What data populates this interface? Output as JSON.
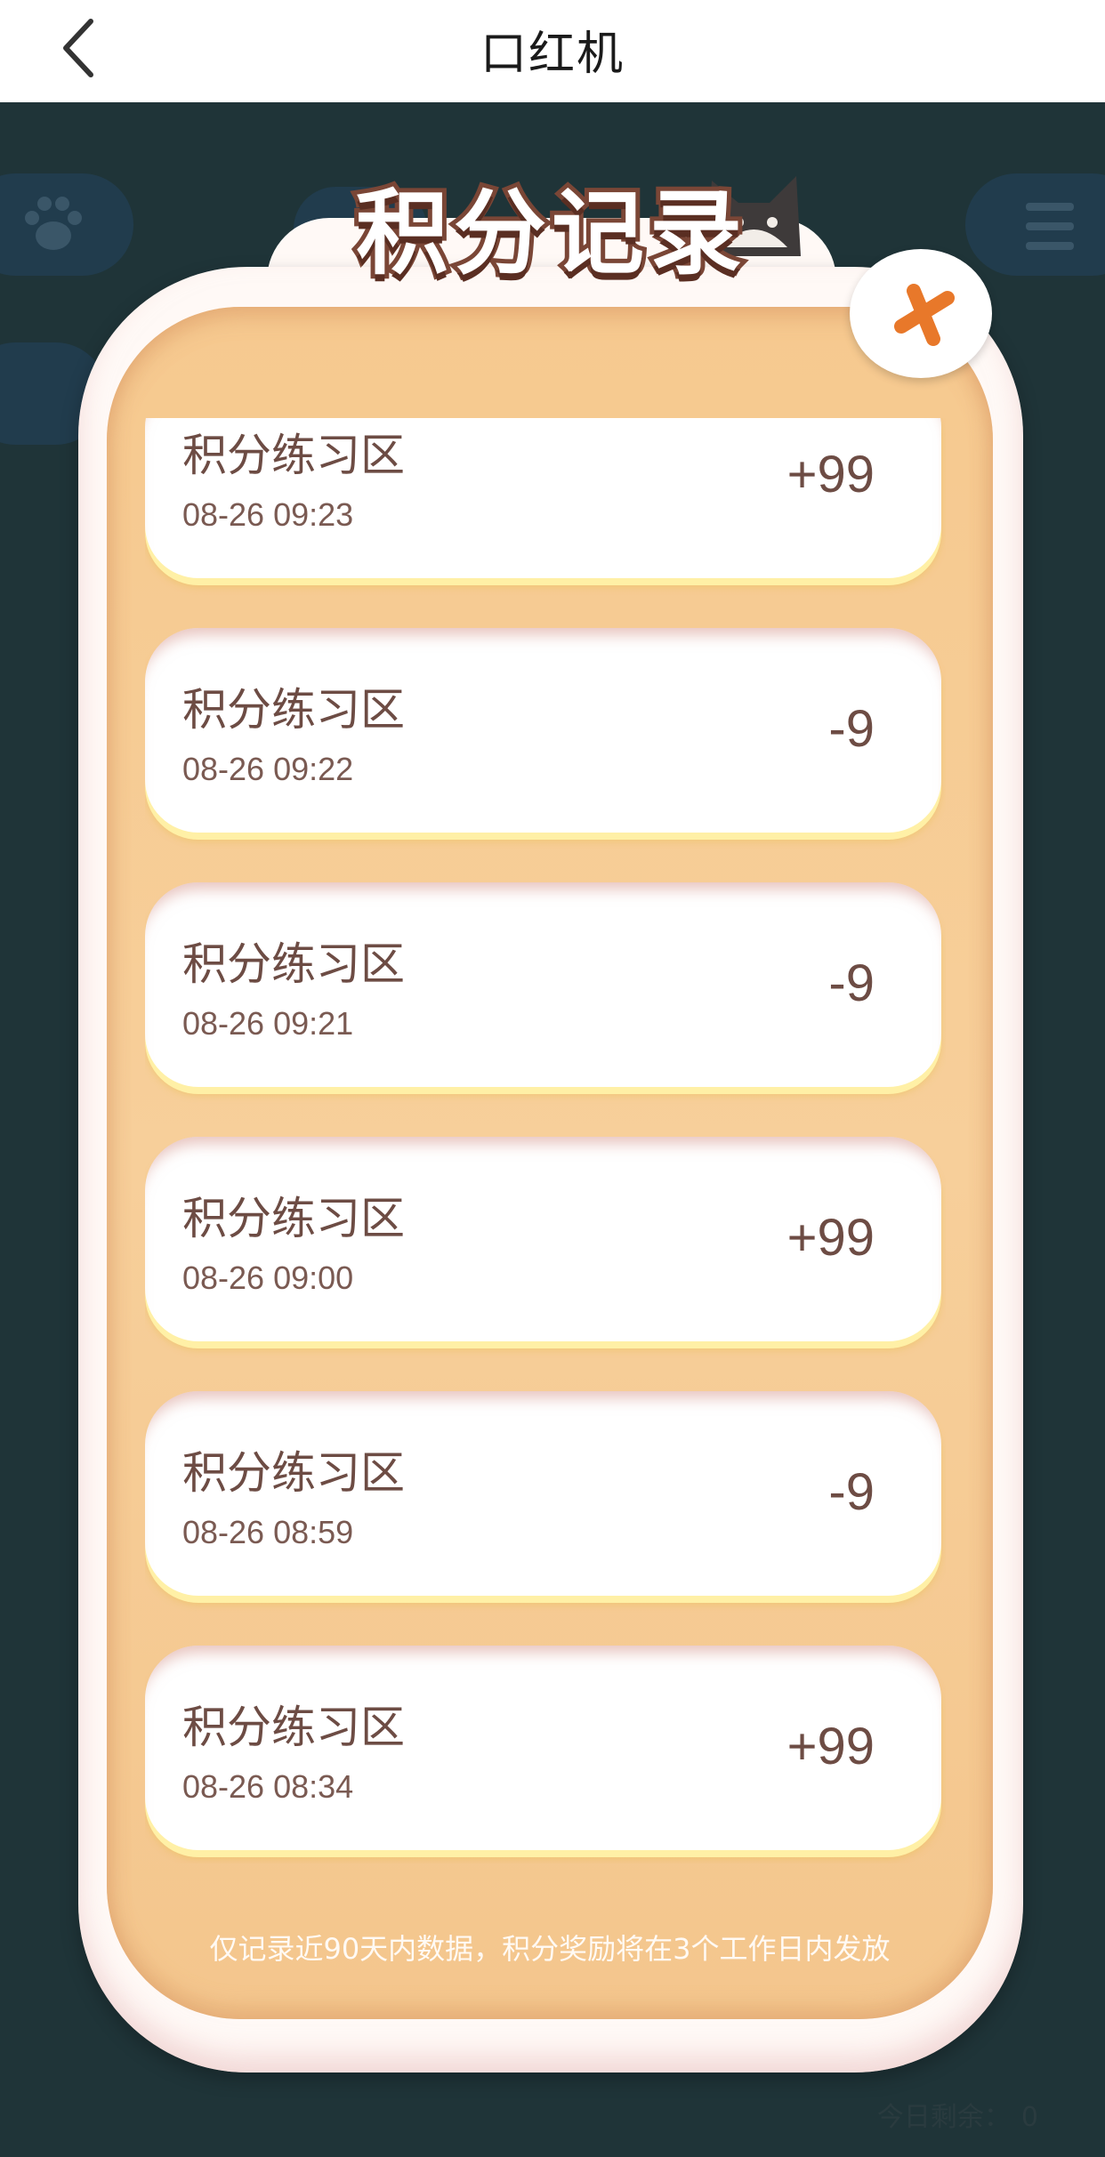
{
  "navbar": {
    "title": "口红机"
  },
  "game_bg": {
    "remaining_label": "今日剩余：",
    "remaining_value": "0"
  },
  "modal": {
    "title": "积分记录",
    "records": [
      {
        "name": "积分练习区",
        "time": "08-26 09:23",
        "points": "+99"
      },
      {
        "name": "积分练习区",
        "time": "08-26 09:22",
        "points": "-9"
      },
      {
        "name": "积分练习区",
        "time": "08-26 09:21",
        "points": "-9"
      },
      {
        "name": "积分练习区",
        "time": "08-26 09:00",
        "points": "+99"
      },
      {
        "name": "积分练习区",
        "time": "08-26 08:59",
        "points": "-9"
      },
      {
        "name": "积分练习区",
        "time": "08-26 08:34",
        "points": "+99"
      }
    ],
    "footer_note": "仅记录近90天内数据，积分奖励将在3个工作日内发放"
  },
  "colors": {
    "navbar_bg": "#ffffff",
    "page_bg": "#1f3438",
    "panel_bg": "#f6c98f",
    "record_text": "#6d4c44",
    "close_cross": "#e8782a",
    "title_outline": "#7a4636"
  },
  "icons": {
    "back": "chevron-left-icon",
    "close": "close-icon",
    "paw": "paw-icon",
    "menu": "menu-icon",
    "cat": "cat-icon"
  }
}
